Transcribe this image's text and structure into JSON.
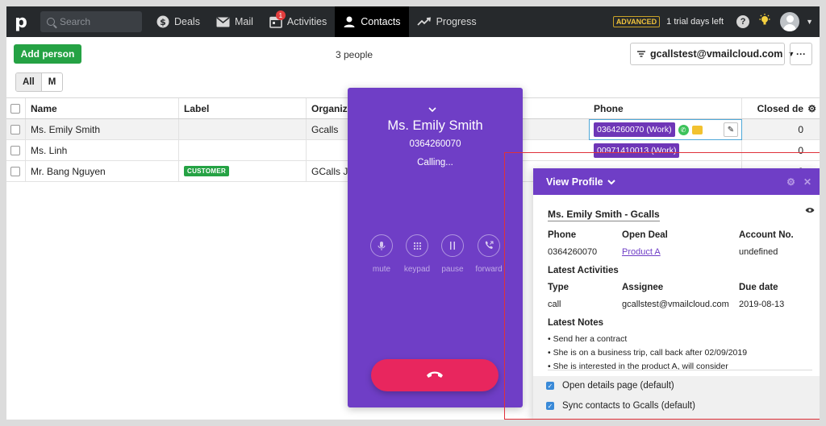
{
  "nav": {
    "logo": "p",
    "search_placeholder": "Search",
    "items": [
      {
        "label": "Deals",
        "icon": "dollar-icon"
      },
      {
        "label": "Mail",
        "icon": "mail-icon"
      },
      {
        "label": "Activities",
        "icon": "calendar-icon",
        "badge": "1"
      },
      {
        "label": "Contacts",
        "icon": "person-icon",
        "active": true
      },
      {
        "label": "Progress",
        "icon": "trend-icon"
      }
    ],
    "plan_badge": "ADVANCED",
    "trial_text": "1 trial days left",
    "help": "?"
  },
  "toolbar": {
    "add_label": "Add person",
    "count": "3 people",
    "filter_value": "gcallstest@vmailcloud.com",
    "more": "···",
    "seg_all": "All",
    "seg_m": "M"
  },
  "table": {
    "headers": {
      "name": "Name",
      "label": "Label",
      "org": "Organiza",
      "phone": "Phone",
      "closed": "Closed de"
    },
    "rows": [
      {
        "name": "Ms. Emily Smith",
        "label": "",
        "org": "Gcalls",
        "phone": "0364260070 (Work)",
        "closed": "0"
      },
      {
        "name": "Ms. Linh",
        "label": "",
        "org": "",
        "phone": "00971410013 (Work)",
        "closed": "0"
      },
      {
        "name": "Mr. Bang Nguyen",
        "label": "CUSTOMER",
        "org": "GCalls JS",
        "phone": "",
        "closed": "0"
      }
    ],
    "partial_text": "(W"
  },
  "call": {
    "name": "Ms. Emily Smith",
    "number": "0364260070",
    "status": "Calling...",
    "controls": [
      {
        "label": "mute",
        "icon": "mic-icon"
      },
      {
        "label": "keypad",
        "icon": "keypad-icon"
      },
      {
        "label": "pause",
        "icon": "pause-icon"
      },
      {
        "label": "forward",
        "icon": "forward-call-icon"
      }
    ]
  },
  "profile": {
    "header": "View Profile",
    "name": "Ms. Emily Smith - Gcalls",
    "phone_label": "Phone",
    "phone_value": "0364260070",
    "deal_label": "Open Deal",
    "deal_value": "Product A",
    "account_label": "Account No.",
    "account_value": "undefined",
    "activities_title": "Latest Activities",
    "type_label": "Type",
    "type_value": "call",
    "assignee_label": "Assignee",
    "assignee_value": "gcallstest@vmailcloud.com",
    "due_label": "Due date",
    "due_value": "2019-08-13",
    "notes_title": "Latest Notes",
    "notes": [
      "• Send her a contract",
      "• She is on a business trip, call back after 02/09/2019",
      "• She is interested in the product A, will consider"
    ],
    "option1": "Open details page (default)",
    "option2": "Sync contacts to Gcalls (default)"
  },
  "colors": {
    "purple": "#6f3ec6",
    "green": "#25a244",
    "hangup": "#e8265e",
    "highlight": "#e0313a"
  }
}
